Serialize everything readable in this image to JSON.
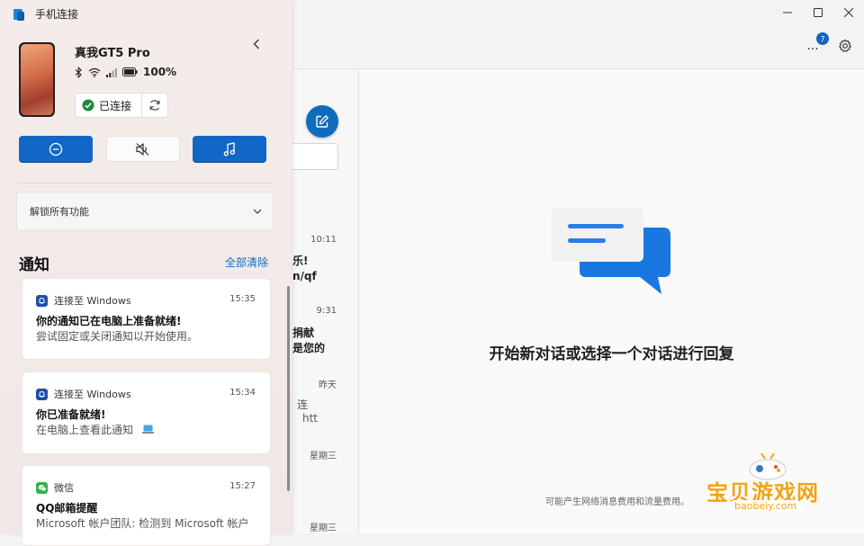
{
  "window": {
    "controls": [
      "minimize",
      "maximize",
      "close"
    ]
  },
  "toolbar": {
    "more_label": "...",
    "badge_count": "7"
  },
  "panel": {
    "app_title": "手机连接",
    "device": {
      "name": "真我GT5 Pro",
      "battery": "100%",
      "connection_status": "已连接"
    },
    "unlock_label": "解锁所有功能",
    "notifications": {
      "heading": "通知",
      "clear_all": "全部清除",
      "items": [
        {
          "app": "连接至 Windows",
          "time": "15:35",
          "title": "你的通知已在电脑上准备就绪!",
          "body": "尝试固定或关闭通知以开始使用。",
          "icon": "bell-icon",
          "color": "#1f4fa8"
        },
        {
          "app": "连接至 Windows",
          "time": "15:34",
          "title": "你已准备就绪!",
          "body": "在电脑上查看此通知",
          "icon": "bell-icon",
          "color": "#1f4fa8"
        },
        {
          "app": "微信",
          "time": "15:27",
          "title": "QQ邮箱提醒",
          "body": "Microsoft 帐户团队: 检测到 Microsoft 帐户",
          "icon": "wechat-icon",
          "color": "#2fb34a"
        }
      ]
    }
  },
  "conversations": {
    "items": [
      {
        "time": "10:11",
        "line1": "乐!",
        "line2": "n/qf"
      },
      {
        "time": "9:31",
        "line1": "捐献",
        "line2": "是您的"
      },
      {
        "time": "昨天",
        "line1": "连",
        "line2": "htt"
      },
      {
        "time": "星期三"
      },
      {
        "time": "星期三"
      }
    ]
  },
  "main": {
    "empty_title": "开始新对话或选择一个对话进行回复",
    "footer": "可能产生网络消息费用和流量费用。"
  },
  "watermark": {
    "text": "宝贝游戏网",
    "url": "baobeiy.com"
  },
  "colors": {
    "accent": "#0f6cbd",
    "quick_button_blue": "#1167c5",
    "connected_green": "#1f8a3b"
  }
}
